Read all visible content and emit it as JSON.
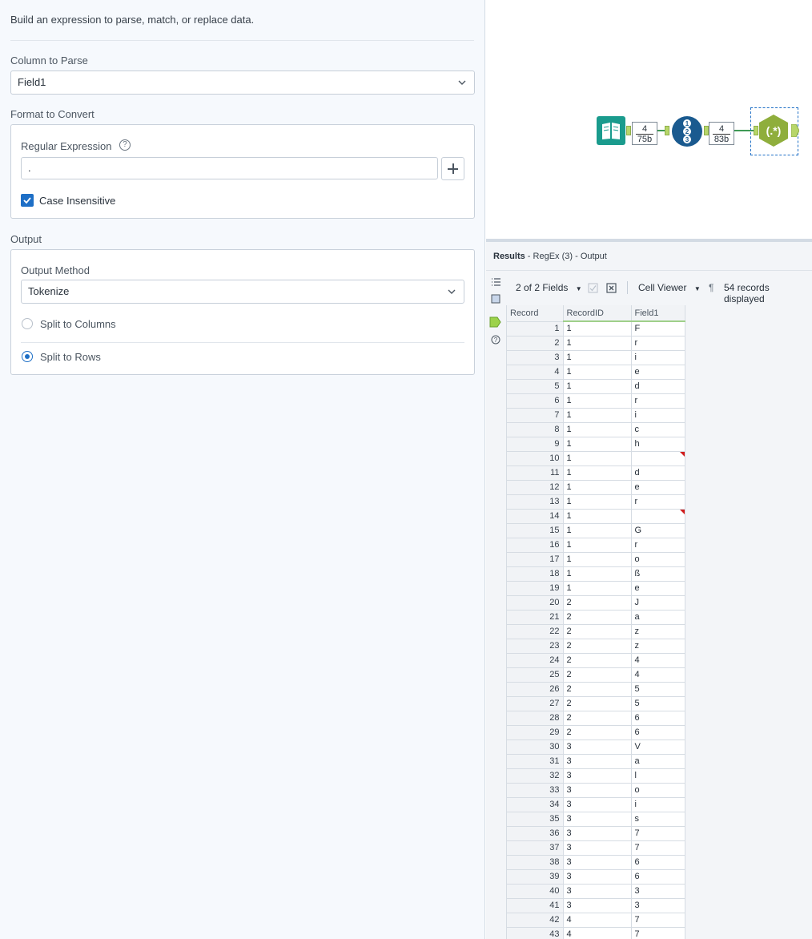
{
  "config": {
    "intro": "Build an expression to parse, match, or replace data.",
    "column_to_parse": {
      "label": "Column to Parse",
      "value": "Field1"
    },
    "format_to_convert": {
      "label": "Format to Convert",
      "regex_label": "Regular Expression",
      "regex_value": ".",
      "case_insensitive_label": "Case Insensitive",
      "case_insensitive_checked": true
    },
    "output": {
      "label": "Output",
      "method_label": "Output Method",
      "method_value": "Tokenize",
      "split_columns_label": "Split to Columns",
      "split_rows_label": "Split to Rows",
      "selected": "Split to Rows"
    }
  },
  "canvas": {
    "badge1": {
      "records": "4",
      "size": "75b"
    },
    "badge2": {
      "records": "4",
      "size": "83b"
    },
    "regex_tool_label": "(.*)"
  },
  "results": {
    "title_bold": "Results",
    "title_rest": " - RegEx (3) - Output",
    "fields_label": "2 of 2 Fields",
    "viewer_label": "Cell Viewer",
    "records_label": "54 records displayed",
    "columns": [
      "Record",
      "RecordID",
      "Field1"
    ],
    "rows": [
      [
        "1",
        "1",
        "F"
      ],
      [
        "2",
        "1",
        "r"
      ],
      [
        "3",
        "1",
        "i"
      ],
      [
        "4",
        "1",
        "e"
      ],
      [
        "5",
        "1",
        "d"
      ],
      [
        "6",
        "1",
        "r"
      ],
      [
        "7",
        "1",
        "i"
      ],
      [
        "8",
        "1",
        "c"
      ],
      [
        "9",
        "1",
        "h"
      ],
      [
        "10",
        "1",
        ""
      ],
      [
        "11",
        "1",
        "d"
      ],
      [
        "12",
        "1",
        "e"
      ],
      [
        "13",
        "1",
        "r"
      ],
      [
        "14",
        "1",
        ""
      ],
      [
        "15",
        "1",
        "G"
      ],
      [
        "16",
        "1",
        "r"
      ],
      [
        "17",
        "1",
        "o"
      ],
      [
        "18",
        "1",
        "ß"
      ],
      [
        "19",
        "1",
        "e"
      ],
      [
        "20",
        "2",
        "J"
      ],
      [
        "21",
        "2",
        "a"
      ],
      [
        "22",
        "2",
        "z"
      ],
      [
        "23",
        "2",
        "z"
      ],
      [
        "24",
        "2",
        "4"
      ],
      [
        "25",
        "2",
        "4"
      ],
      [
        "26",
        "2",
        "5"
      ],
      [
        "27",
        "2",
        "5"
      ],
      [
        "28",
        "2",
        "6"
      ],
      [
        "29",
        "2",
        "6"
      ],
      [
        "30",
        "3",
        "V"
      ],
      [
        "31",
        "3",
        "a"
      ],
      [
        "32",
        "3",
        "l"
      ],
      [
        "33",
        "3",
        "o"
      ],
      [
        "34",
        "3",
        "i"
      ],
      [
        "35",
        "3",
        "s"
      ],
      [
        "36",
        "3",
        "7"
      ],
      [
        "37",
        "3",
        "7"
      ],
      [
        "38",
        "3",
        "6"
      ],
      [
        "39",
        "3",
        "6"
      ],
      [
        "40",
        "3",
        "3"
      ],
      [
        "41",
        "3",
        "3"
      ],
      [
        "42",
        "4",
        "7"
      ],
      [
        "43",
        "4",
        "7"
      ]
    ]
  },
  "colors": {
    "accent": "#1e6fc6",
    "connector": "#3f9a55",
    "regex_tool": "#8fae3c",
    "input_tool": "#1a9b8d",
    "recordid_tool": "#1a5a8f"
  }
}
